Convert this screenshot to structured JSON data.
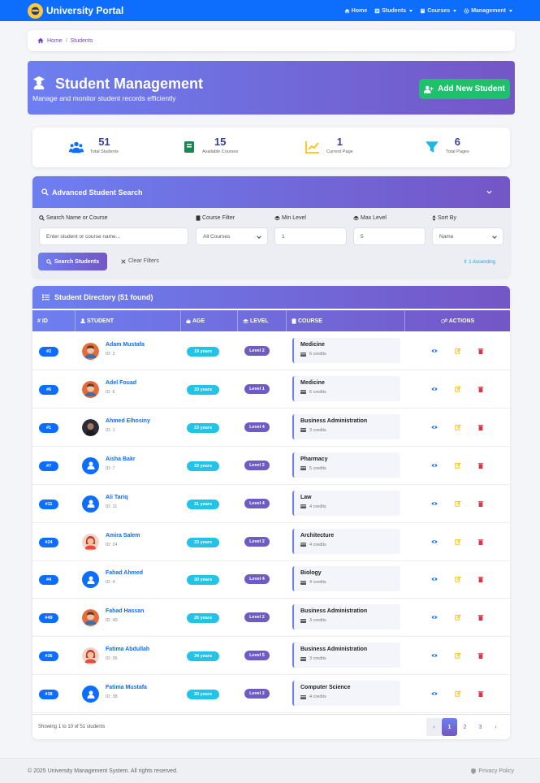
{
  "colors": {
    "primary": "#0d6efd",
    "purple": "#7456c6",
    "success": "#1fbf6e",
    "info": "#22c3e6",
    "warning": "#ffc107",
    "danger": "#dc3545"
  },
  "navbar": {
    "brand": "University Portal",
    "links": [
      {
        "label": "Home",
        "icon": "home-icon"
      },
      {
        "label": "Students",
        "icon": "students-icon",
        "dropdown": true
      },
      {
        "label": "Courses",
        "icon": "book-icon",
        "dropdown": true
      },
      {
        "label": "Management",
        "icon": "gear-icon",
        "dropdown": true
      }
    ]
  },
  "breadcrumb": {
    "home": "Home",
    "sep": "/",
    "current": "Students"
  },
  "hero": {
    "title": "Student Management",
    "subtitle": "Manage and monitor student records efficiently",
    "add_button": "Add New Student"
  },
  "stats": [
    {
      "value": "51",
      "label": "Total Students",
      "icon": "users-icon"
    },
    {
      "value": "15",
      "label": "Available Courses",
      "icon": "book-icon"
    },
    {
      "value": "1",
      "label": "Current Page",
      "icon": "chart-line-icon"
    },
    {
      "value": "6",
      "label": "Total Pages",
      "icon": "filter-icon"
    }
  ],
  "search": {
    "title": "Advanced Student Search",
    "labels": {
      "name": "Search Name or Course",
      "course": "Course Filter",
      "min": "Min Level",
      "max": "Max Level",
      "sort": "Sort By"
    },
    "placeholder": "Enter student or course name...",
    "course_value": "All Courses",
    "min_value": "1",
    "max_value": "5",
    "sort_value": "Name",
    "search_button": "Search Students",
    "clear_button": "Clear Filters",
    "sort_indicator": "1 Ascending"
  },
  "table": {
    "title": "Student Directory (51 found)",
    "columns": [
      "ID",
      "STUDENT",
      "AGE",
      "LEVEL",
      "COURSE",
      "ACTIONS"
    ],
    "rows": [
      {
        "id": "#2",
        "name": "Adam Mustafa",
        "sid": "ID: 2",
        "age": "19 years",
        "level": "Level 2",
        "course": "Medicine",
        "credits": "6 credits",
        "avatar": "male"
      },
      {
        "id": "#6",
        "name": "Adel Fouad",
        "sid": "ID: 6",
        "age": "33 years",
        "level": "Level 1",
        "course": "Medicine",
        "credits": "6 credits",
        "avatar": "male"
      },
      {
        "id": "#1",
        "name": "Ahmed Elhosiny",
        "sid": "ID: 1",
        "age": "23 years",
        "level": "Level 4",
        "course": "Business Administration",
        "credits": "3 credits",
        "avatar": "photo"
      },
      {
        "id": "#7",
        "name": "Aisha Bakr",
        "sid": "ID: 7",
        "age": "33 years",
        "level": "Level 2",
        "course": "Pharmacy",
        "credits": "5 credits",
        "avatar": "default"
      },
      {
        "id": "#11",
        "name": "Ali Tariq",
        "sid": "ID: 11",
        "age": "31 years",
        "level": "Level 4",
        "course": "Law",
        "credits": "4 credits",
        "avatar": "default"
      },
      {
        "id": "#24",
        "name": "Amira Salem",
        "sid": "ID: 24",
        "age": "33 years",
        "level": "Level 2",
        "course": "Architecture",
        "credits": "4 credits",
        "avatar": "female"
      },
      {
        "id": "#4",
        "name": "Fahad Ahmed",
        "sid": "ID: 4",
        "age": "30 years",
        "level": "Level 4",
        "course": "Biology",
        "credits": "4 credits",
        "avatar": "default"
      },
      {
        "id": "#49",
        "name": "Fahad Hassan",
        "sid": "ID: 49",
        "age": "26 years",
        "level": "Level 2",
        "course": "Business Administration",
        "credits": "3 credits",
        "avatar": "male"
      },
      {
        "id": "#36",
        "name": "Fatima Abdullah",
        "sid": "ID: 36",
        "age": "34 years",
        "level": "Level 5",
        "course": "Business Administration",
        "credits": "3 credits",
        "avatar": "female"
      },
      {
        "id": "#38",
        "name": "Fatima Mustafa",
        "sid": "ID: 38",
        "age": "20 years",
        "level": "Level 2",
        "course": "Computer Science",
        "credits": "4 credits",
        "avatar": "default"
      }
    ],
    "showing": "Showing 1 to 10 of 51 students",
    "pages": [
      "1",
      "2",
      "3"
    ]
  },
  "footer": {
    "copyright": "© 2025 University Management System. All rights reserved.",
    "privacy": "Privacy Policy"
  }
}
